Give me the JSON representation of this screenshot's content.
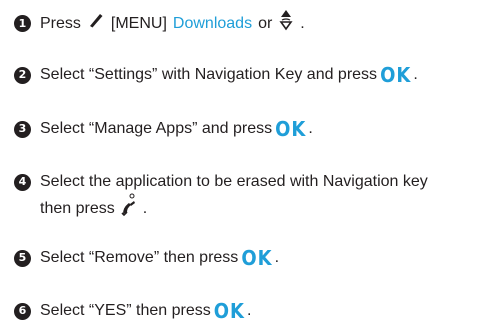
{
  "steps": [
    {
      "number": "1",
      "parts": {
        "press": "Press",
        "menu": "[MENU]",
        "downloads": "Downloads",
        "or": "or",
        "end": "."
      },
      "icons": [
        "pen-soft-key-icon",
        "navigation-up-down-icon"
      ]
    },
    {
      "number": "2",
      "text": "Select “Settings” with Navigation Key and press",
      "ok": "OK",
      "end": "."
    },
    {
      "number": "3",
      "text": "Select “Manage Apps” and press",
      "ok": "OK",
      "end": "."
    },
    {
      "number": "4",
      "text_line1": "Select the application to be erased with Navigation key",
      "text_line2": "then press",
      "end": ".",
      "icons": [
        "send-call-key-icon"
      ]
    },
    {
      "number": "5",
      "text": "Select “Remove” then press",
      "ok": "OK",
      "end": "."
    },
    {
      "number": "6",
      "text": "Select “YES” then press",
      "ok": "OK",
      "end": "."
    }
  ],
  "colors": {
    "text": "#231f20",
    "accent": "#1f9ed8",
    "bullet": "#231f20"
  }
}
